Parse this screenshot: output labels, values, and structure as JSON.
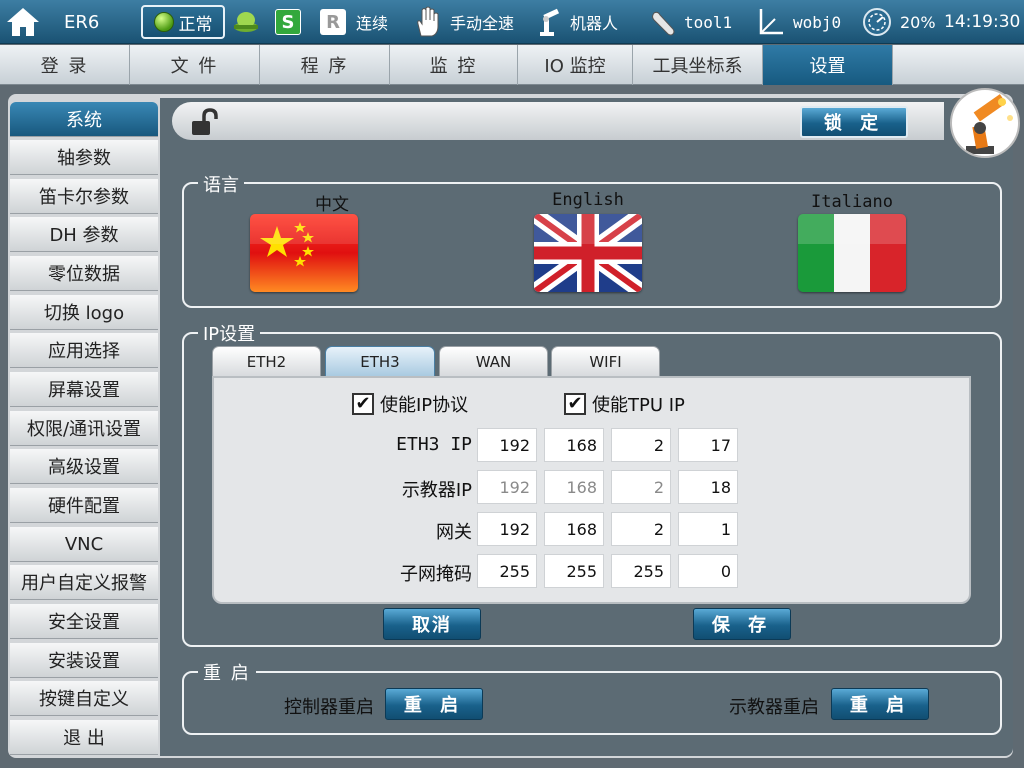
{
  "topbar": {
    "model": "ER6",
    "status": "正常",
    "mode_s": "S",
    "mode_r": "R",
    "run_mode": "连续",
    "speed": "手动全速",
    "robot": "机器人",
    "tool": "tool1",
    "wobj": "wobj0",
    "speed_pct": "20%",
    "time": "14:19:30",
    "colors": {
      "s_badge": "#33a83c",
      "r_badge": "#ffffff"
    }
  },
  "main_tabs": [
    {
      "label": "登 录"
    },
    {
      "label": "文 件"
    },
    {
      "label": "程 序"
    },
    {
      "label": "监 控"
    },
    {
      "label": "IO 监控"
    },
    {
      "label": "工具坐标系"
    },
    {
      "label": "设置",
      "active": true
    }
  ],
  "sidebar": {
    "items": [
      {
        "label": "系统",
        "active": true
      },
      {
        "label": "轴参数"
      },
      {
        "label": "笛卡尔参数"
      },
      {
        "label": "DH 参数"
      },
      {
        "label": "零位数据"
      },
      {
        "label": "切换 logo"
      },
      {
        "label": "应用选择"
      },
      {
        "label": "屏幕设置"
      },
      {
        "label": "权限/通讯设置"
      },
      {
        "label": "高级设置"
      },
      {
        "label": "硬件配置"
      },
      {
        "label": "VNC"
      },
      {
        "label": "用户自定义报警"
      },
      {
        "label": "安全设置"
      },
      {
        "label": "安装设置"
      },
      {
        "label": "按键自定义"
      },
      {
        "label": "退 出"
      }
    ]
  },
  "lock_button": "锁 定",
  "language": {
    "title": "语言",
    "options": [
      {
        "label": "中文",
        "flag": "cn-flag"
      },
      {
        "label": "English",
        "flag": "uk-flag"
      },
      {
        "label": "Italiano",
        "flag": "it-flag"
      }
    ]
  },
  "ip": {
    "title": "IP设置",
    "tabs": [
      {
        "label": "ETH2"
      },
      {
        "label": "ETH3",
        "active": true
      },
      {
        "label": "WAN"
      },
      {
        "label": "WIFI"
      }
    ],
    "enable_ip": {
      "label": "使能IP协议",
      "checked": true
    },
    "enable_tpu": {
      "label": "使能TPU IP",
      "checked": true
    },
    "rows": [
      {
        "label": "ETH3 IP",
        "octets": [
          "192",
          "168",
          "2",
          "17"
        ]
      },
      {
        "label": "示教器IP",
        "octets": [
          "192",
          "168",
          "2",
          "18"
        ]
      },
      {
        "label": "网关",
        "octets": [
          "192",
          "168",
          "2",
          "1"
        ]
      },
      {
        "label": "子网掩码",
        "octets": [
          "255",
          "255",
          "255",
          "0"
        ]
      }
    ],
    "cancel": "取消",
    "save": "保 存"
  },
  "restart": {
    "title": "重 启",
    "controller_label": "控制器重启",
    "pendant_label": "示教器重启",
    "button": "重 启"
  }
}
